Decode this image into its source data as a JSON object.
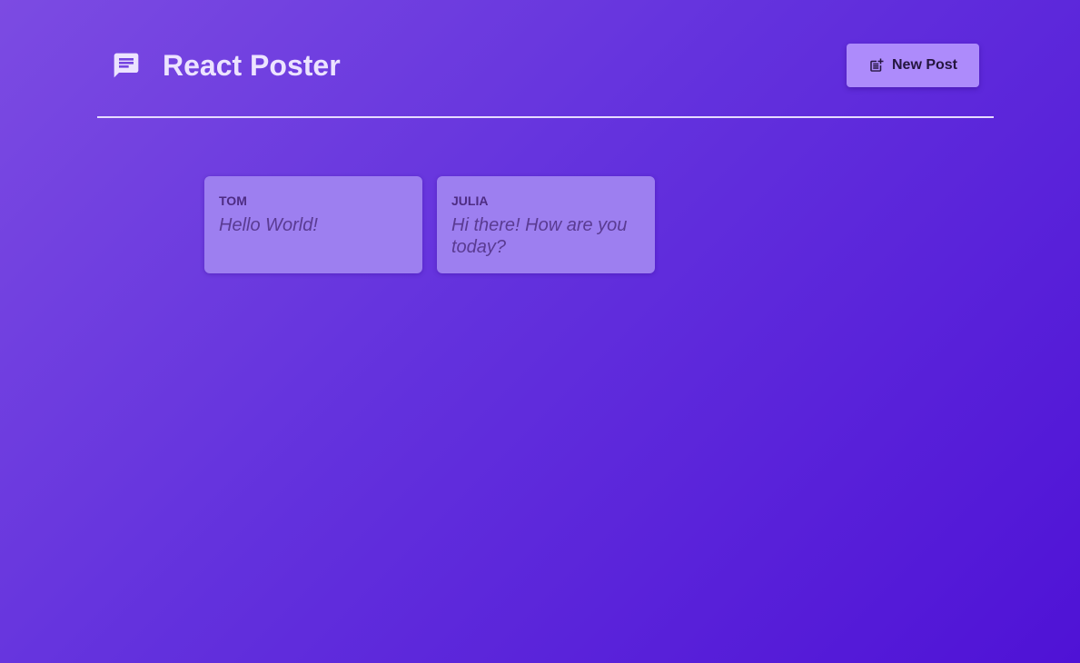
{
  "app": {
    "title": "React Poster",
    "logo_icon": "message-icon",
    "new_post_label": "New Post",
    "new_post_icon": "post-add-icon"
  },
  "colors": {
    "background_start": "#7c4be2",
    "background_end": "#4f12d6",
    "button": "#ad8bfb",
    "card": "#9d7ff0"
  },
  "posts": [
    {
      "author": "Tom",
      "body": "Hello World!"
    },
    {
      "author": "Julia",
      "body": "Hi there! How are you today?"
    }
  ]
}
